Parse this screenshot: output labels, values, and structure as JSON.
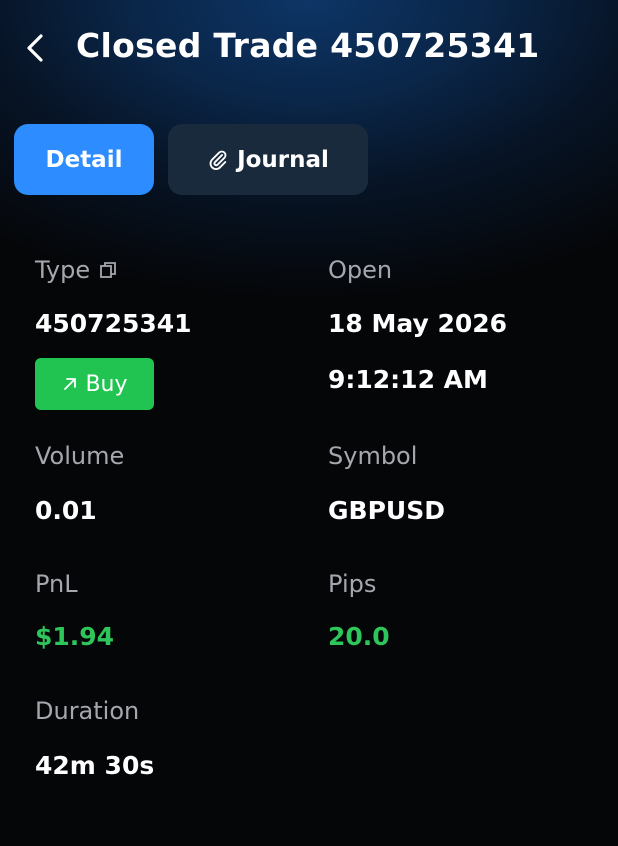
{
  "header": {
    "title": "Closed Trade 450725341"
  },
  "tabs": [
    {
      "label": "Detail",
      "active": true
    },
    {
      "label": "Journal",
      "active": false
    }
  ],
  "fields": {
    "type": {
      "label": "Type",
      "value": "450725341",
      "badge": "Buy"
    },
    "open": {
      "label": "Open",
      "date": "18 May 2026",
      "time": "9:12:12 AM"
    },
    "volume": {
      "label": "Volume",
      "value": "0.01"
    },
    "symbol": {
      "label": "Symbol",
      "value": "GBPUSD"
    },
    "pnl": {
      "label": "PnL",
      "value": "$1.94"
    },
    "pips": {
      "label": "Pips",
      "value": "20.0"
    },
    "duration": {
      "label": "Duration",
      "value": "42m 30s"
    }
  },
  "colors": {
    "accent": "#2d8cff",
    "positive": "#2ec55a",
    "badge": "#21c451",
    "background": "#050608"
  },
  "icons": {
    "back": "chevron-left-icon",
    "journal": "paperclip-icon",
    "copy": "copy-icon",
    "buy": "arrow-up-right-icon"
  }
}
